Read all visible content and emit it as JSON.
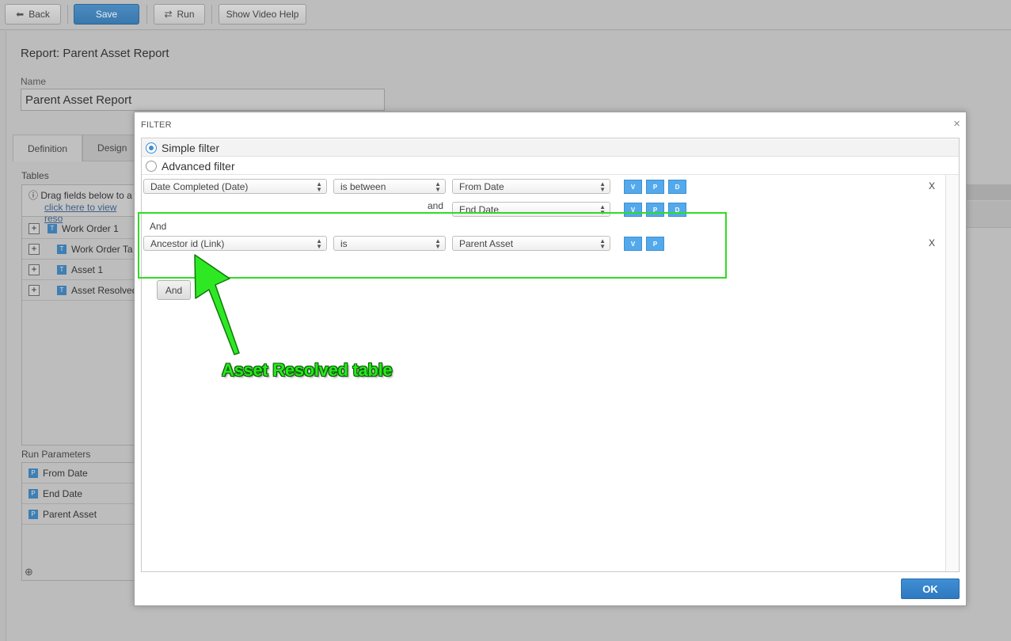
{
  "toolbar": {
    "back_label": "Back",
    "save_label": "Save",
    "run_label": "Run",
    "video_help_label": "Show Video Help"
  },
  "page": {
    "report_title": "Report: Parent Asset Report",
    "name_label": "Name",
    "name_value": "Parent Asset Report",
    "tabs": [
      {
        "label": "Definition"
      },
      {
        "label": "Design"
      }
    ],
    "tables_label": "Tables",
    "hint_text": "Drag fields below to a",
    "hint_link": "click here to view reso",
    "tree": [
      {
        "label": "Work Order 1",
        "badge": "T"
      },
      {
        "label": "Work Order Ta",
        "badge": "T"
      },
      {
        "label": "Asset 1",
        "badge": "T"
      },
      {
        "label": "Asset Resolved",
        "badge": "T"
      }
    ],
    "run_params_label": "Run Parameters",
    "params": [
      {
        "label": "From Date",
        "badge": "P"
      },
      {
        "label": "End Date",
        "badge": "P"
      },
      {
        "label": "Parent Asset",
        "badge": "P"
      }
    ]
  },
  "modal": {
    "title": "FILTER",
    "close_glyph": "×",
    "simple_filter_label": "Simple filter",
    "advanced_filter_label": "Advanced filter",
    "row1": {
      "field": "Date Completed (Date)",
      "operator": "is between",
      "value": "From Date",
      "buttons": [
        "V",
        "P",
        "D"
      ],
      "remove": "X"
    },
    "row1b": {
      "connector": "and",
      "value": "End Date",
      "buttons": [
        "V",
        "P",
        "D"
      ]
    },
    "group2": {
      "label": "And",
      "field": "Ancestor id (Link)",
      "operator": "is",
      "value": "Parent Asset",
      "buttons": [
        "V",
        "P"
      ],
      "remove": "X"
    },
    "and_button": "And",
    "ok_label": "OK"
  },
  "annotation": {
    "text": "Asset Resolved table",
    "color": "#27e81c"
  }
}
